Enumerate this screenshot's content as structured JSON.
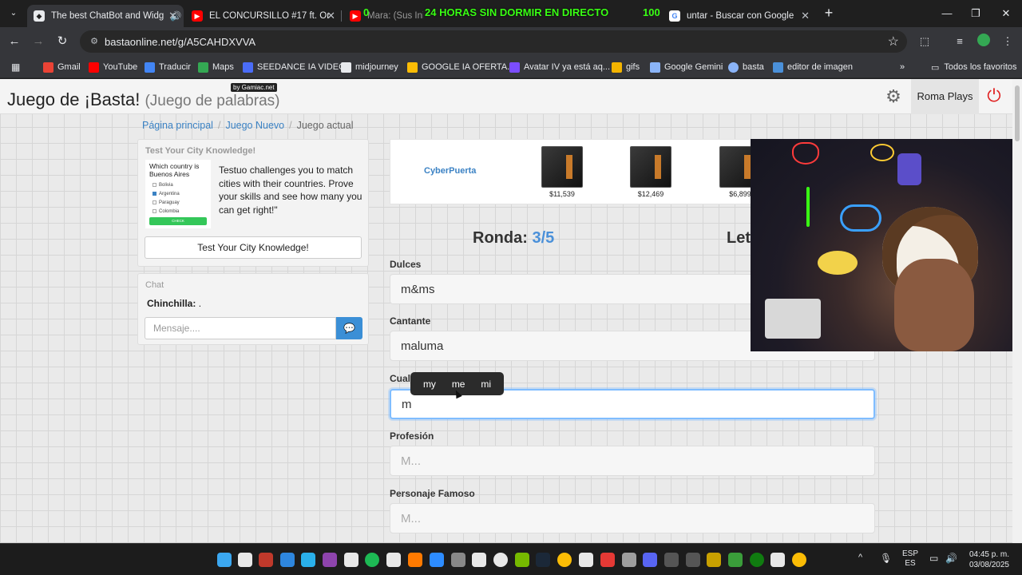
{
  "browser": {
    "tabs": [
      {
        "title": "The best ChatBot and Widg",
        "color": "#e8eaed"
      },
      {
        "title": "EL CONCURSILLO #17 ft. Or",
        "color": "#ff0000"
      },
      {
        "title": "Mara: (Sus Inicio",
        "color": "#ff0000"
      },
      {
        "title": "untar - Buscar con Google",
        "color": "#4285f4"
      }
    ],
    "overlay_banner": "24 HORAS SIN DORMIR EN DIRECTO",
    "overlay_count": "100",
    "overlay_zero": "0",
    "url": "bastaonline.net/g/A5CAHDXVVA",
    "bookmarks": [
      {
        "label": "Gmail",
        "color": "#ea4335"
      },
      {
        "label": "YouTube",
        "color": "#ff0000"
      },
      {
        "label": "Traducir",
        "color": "#4285f4"
      },
      {
        "label": "Maps",
        "color": "#34a853"
      },
      {
        "label": "SEEDANCE IA VIDEO",
        "color": "#4a6cf7"
      },
      {
        "label": "midjourney",
        "color": "#e8eaed"
      },
      {
        "label": "GOOGLE IA OFERTA...",
        "color": "#fbbc05"
      },
      {
        "label": "Avatar IV ya está aq...",
        "color": "#7b4dff"
      },
      {
        "label": "gifs",
        "color": "#f4b400"
      },
      {
        "label": "Google Gemini",
        "color": "#8ab4f8"
      },
      {
        "label": "basta",
        "color": "#8ab4f8"
      },
      {
        "label": "editor de imagen",
        "color": "#4a90d9"
      }
    ],
    "all_bookmarks": "Todos los favoritos"
  },
  "header": {
    "title": "Juego de ¡Basta!",
    "subtitle": "(Juego de palabras)",
    "badge": "by Gamiac.net",
    "user": "Roma Plays"
  },
  "breadcrumb": {
    "home": "Página principal",
    "new_game": "Juego Nuevo",
    "current": "Juego actual"
  },
  "ad": {
    "title": "Test Your City Knowledge!",
    "question": "Which country is Buenos Aires",
    "options": [
      "Bolivia",
      "Argentina",
      "Paraguay",
      "Colombia"
    ],
    "thumb_button": "CHECK",
    "description": "Testuo challenges you to match cities with their countries. Prove your skills and see how many you can get right!\"",
    "button": "Test Your City Knowledge!"
  },
  "chat": {
    "title": "Chat",
    "sender": "Chinchilla:",
    "message": ".",
    "placeholder": "Mensaje...."
  },
  "products": {
    "brand_a": "CyberPuerta",
    "brand_b": "",
    "items": [
      {
        "price": "$11,539"
      },
      {
        "price": "$12,469"
      },
      {
        "price": "$6,899"
      }
    ]
  },
  "game": {
    "round_label": "Ronda:",
    "round_value": "3/5",
    "letter_label": "Let",
    "fields": [
      {
        "label": "Dulces",
        "value": "m&ms",
        "placeholder": ""
      },
      {
        "label": "Cantante",
        "value": "maluma",
        "placeholder": ""
      },
      {
        "label": "Cual",
        "value": "m",
        "placeholder": ""
      },
      {
        "label": "Profesión",
        "value": "",
        "placeholder": "M..."
      },
      {
        "label": "Personaje Famoso",
        "value": "",
        "placeholder": "M..."
      }
    ],
    "suggestions": [
      "my",
      "me",
      "mi"
    ]
  },
  "taskbar": {
    "lang": "ESP",
    "lang_sub": "ES",
    "time": "04:45 p. m.",
    "date": "03/08/2025"
  }
}
